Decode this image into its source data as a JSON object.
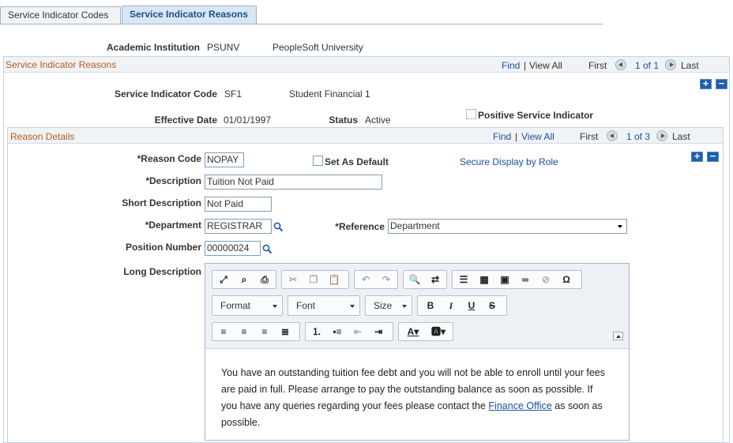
{
  "tabs": [
    {
      "label": "Service Indicator Codes",
      "active": false
    },
    {
      "label": "Service Indicator Reasons",
      "active": true
    }
  ],
  "header": {
    "institution_label": "Academic Institution",
    "institution_code": "PSUNV",
    "institution_name": "PeopleSoft University"
  },
  "outer_grid": {
    "title": "Service Indicator Reasons",
    "find": "Find",
    "sep": "|",
    "view_all": "View All",
    "first": "First",
    "count": "1 of 1",
    "last": "Last",
    "code_label": "Service Indicator Code",
    "code_value": "SF1",
    "code_desc": "Student Financial 1",
    "positive_label": "Positive Service Indicator",
    "effdate_label": "Effective Date",
    "effdate_value": "01/01/1997",
    "status_label": "Status",
    "status_value": "Active"
  },
  "reason_grid": {
    "title": "Reason Details",
    "find": "Find",
    "sep": "|",
    "view_all": "View All",
    "first": "First",
    "count": "1 of 3",
    "last": "Last",
    "reason_code_label": "*Reason Code",
    "reason_code_value": "NOPAY",
    "set_default_label": "Set As Default",
    "secure_display_link": "Secure Display by Role",
    "description_label": "*Description",
    "description_value": "Tuition Not Paid",
    "short_desc_label": "Short Description",
    "short_desc_value": "Not Paid",
    "department_label": "*Department",
    "department_value": "REGISTRAR",
    "reference_label": "*Reference",
    "reference_value": "Department",
    "position_label": "Position Number",
    "position_value": "00000024",
    "long_desc_label": "Long Description"
  },
  "editor": {
    "format_label": "Format",
    "font_label": "Font",
    "size_label": "Size",
    "text_before": "You have an outstanding tuition fee debt and you will not be able to enroll until your fees are paid in full. Please arrange to pay the outstanding balance as soon as possible. If you have any queries regarding your fees please contact the",
    "link_text": "Finance Office",
    "text_after": "as soon as possible."
  },
  "colors": {
    "accent": "#1b4fa0",
    "section_title": "#b85a1a",
    "tab_active": "#d9e7f5"
  }
}
